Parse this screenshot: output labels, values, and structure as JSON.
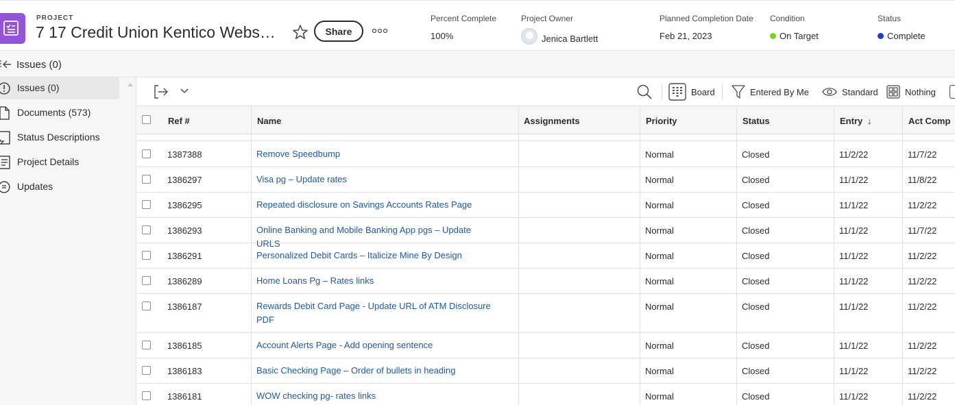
{
  "header": {
    "project_label": "PROJECT",
    "title": "7 17 Credit Union Kentico Websit...",
    "share_label": "Share",
    "meta": {
      "percent_complete": {
        "label": "Percent Complete",
        "value": "100%"
      },
      "owner": {
        "label": "Project Owner",
        "value": "Jenica Bartlett"
      },
      "completion": {
        "label": "Planned Completion Date",
        "value": "Feb 21, 2023"
      },
      "condition": {
        "label": "Condition",
        "value": "On Target",
        "color": "#7ed321"
      },
      "status": {
        "label": "Status",
        "value": "Complete",
        "color": "#1f3bd6"
      }
    }
  },
  "subbar": {
    "title": "Issues (0)"
  },
  "sidebar": {
    "items": [
      {
        "label": "Issues (0)",
        "icon": "alert-circle-icon",
        "active": true
      },
      {
        "label": "Documents (573)",
        "icon": "document-icon",
        "active": false
      },
      {
        "label": "Status Descriptions",
        "icon": "status-icon",
        "active": false
      },
      {
        "label": "Project Details",
        "icon": "details-icon",
        "active": false
      },
      {
        "label": "Updates",
        "icon": "chat-icon",
        "active": false
      }
    ]
  },
  "toolbar": {
    "board_label": "Board",
    "filter_label": "Entered By Me",
    "view_label": "Standard",
    "group_label": "Nothing"
  },
  "table": {
    "columns": [
      "Ref #",
      "Name",
      "Assignments",
      "Priority",
      "Status",
      "Entry",
      "Act Comp"
    ],
    "sort_icon": "↓",
    "rows": [
      {
        "ref": "1387388",
        "name": "Remove Speedbump",
        "assignments": "",
        "priority": "Normal",
        "status": "Closed",
        "entry": "11/2/22",
        "act_comp": "11/7/22"
      },
      {
        "ref": "1386297",
        "name": "Visa pg – Update rates",
        "assignments": "",
        "priority": "Normal",
        "status": "Closed",
        "entry": "11/1/22",
        "act_comp": "11/8/22"
      },
      {
        "ref": "1386295",
        "name": "Repeated disclosure on Savings Accounts Rates Page",
        "assignments": "",
        "priority": "Normal",
        "status": "Closed",
        "entry": "11/1/22",
        "act_comp": "11/2/22"
      },
      {
        "ref": "1386293",
        "name": "Online Banking and Mobile Banking App pgs – Update URLS",
        "assignments": "",
        "priority": "Normal",
        "status": "Closed",
        "entry": "11/1/22",
        "act_comp": "11/7/22"
      },
      {
        "ref": "1386291",
        "name": "Personalized Debit Cards – Italicize Mine By Design",
        "assignments": "",
        "priority": "Normal",
        "status": "Closed",
        "entry": "11/1/22",
        "act_comp": "11/2/22"
      },
      {
        "ref": "1386289",
        "name": "Home Loans Pg – Rates links",
        "assignments": "",
        "priority": "Normal",
        "status": "Closed",
        "entry": "11/1/22",
        "act_comp": "11/2/22"
      },
      {
        "ref": "1386187",
        "name": "Rewards Debit Card Page - Update URL of ATM Disclosure PDF",
        "assignments": "",
        "priority": "Normal",
        "status": "Closed",
        "entry": "11/1/22",
        "act_comp": "11/2/22"
      },
      {
        "ref": "1386185",
        "name": "Account Alerts Page - Add opening sentence",
        "assignments": "",
        "priority": "Normal",
        "status": "Closed",
        "entry": "11/1/22",
        "act_comp": "11/2/22"
      },
      {
        "ref": "1386183",
        "name": "Basic Checking Page – Order of bullets in heading",
        "assignments": "",
        "priority": "Normal",
        "status": "Closed",
        "entry": "11/1/22",
        "act_comp": "11/2/22"
      },
      {
        "ref": "1386181",
        "name": "WOW checking pg- rates links",
        "assignments": "",
        "priority": "Normal",
        "status": "Closed",
        "entry": "11/1/22",
        "act_comp": "11/2/22"
      }
    ]
  }
}
